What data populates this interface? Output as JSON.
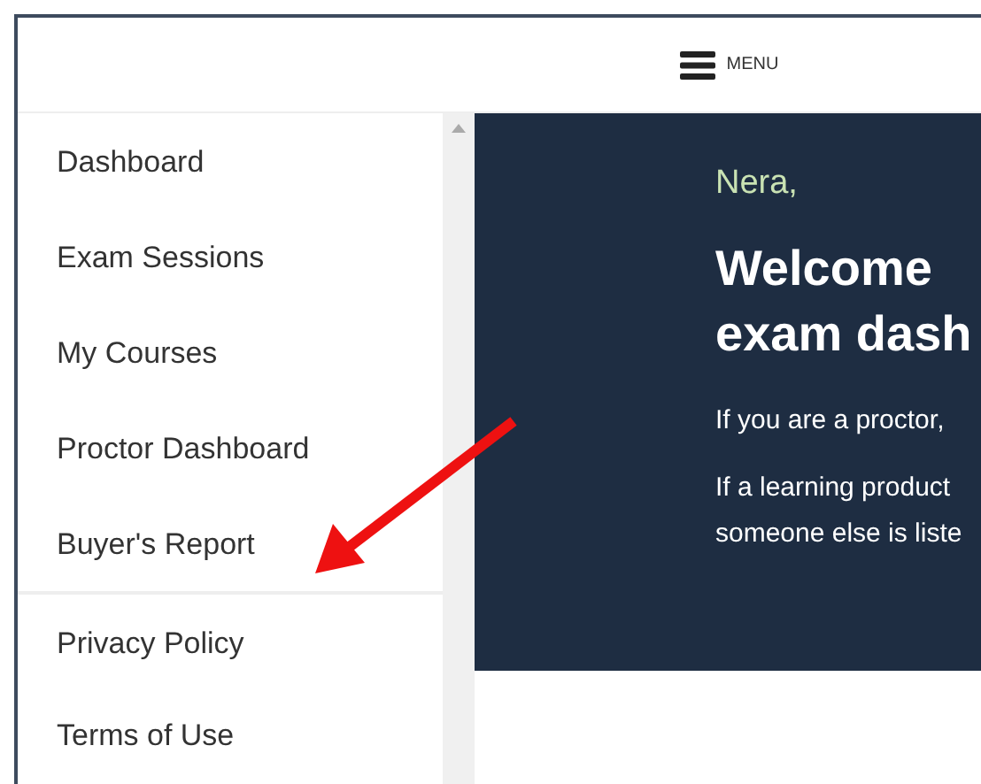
{
  "header": {
    "menu_label": "MENU"
  },
  "sidebar": {
    "main_items": [
      "Dashboard",
      "Exam Sessions",
      "My Courses",
      "Proctor Dashboard",
      "Buyer's Report"
    ],
    "footer_items": [
      "Privacy Policy",
      "Terms of Use"
    ]
  },
  "banner": {
    "greeting": "Nera,",
    "title_lines": [
      "Welcome",
      "exam dash"
    ],
    "paragraphs": [
      [
        "If you are a proctor,"
      ],
      [
        "If a learning product",
        "someone else is liste"
      ]
    ]
  }
}
